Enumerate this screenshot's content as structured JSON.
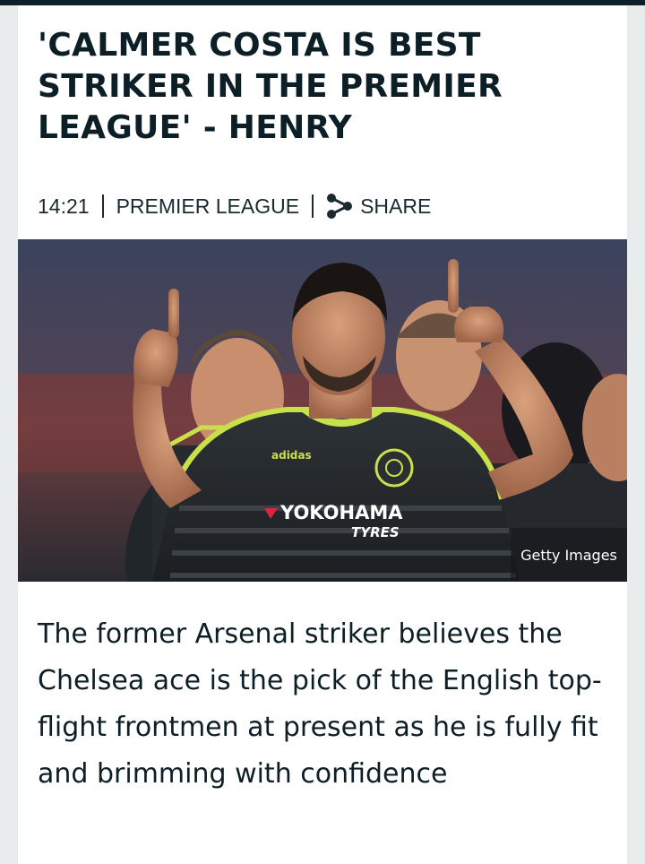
{
  "article": {
    "headline": "'CALMER COSTA IS BEST STRIKER IN THE PREMIER LEAGUE' - HENRY",
    "time": "14:21",
    "category": "PREMIER LEAGUE",
    "share_label": "SHARE",
    "share_icon": "share-icon",
    "image": {
      "credit": "Getty Images",
      "shirt_sponsor": "YOKOHAMA",
      "shirt_sponsor_sub": "TYRES",
      "kit_brand": "adidas"
    },
    "summary": "The former Arsenal striker believes the Chelsea ace is the pick of the English top-flight frontmen at present as he is fully fit and brimming with confidence"
  },
  "colors": {
    "background": "#e9ecec",
    "card": "#ffffff",
    "text": "#0d1f26",
    "top_bar": "#0b2027",
    "kit_accent": "#c8e04a"
  }
}
